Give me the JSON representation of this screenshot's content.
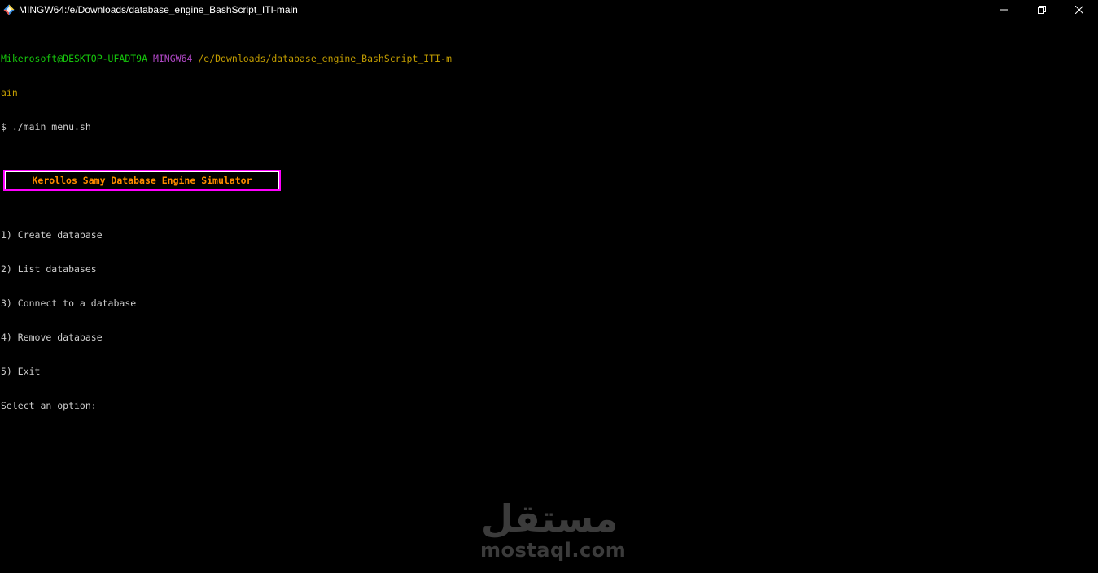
{
  "window": {
    "title": "MINGW64:/e/Downloads/database_engine_BashScript_ITI-main",
    "app_icon": "mingw-diamond-icon",
    "controls": [
      "minimize-icon",
      "restore-icon",
      "close-icon"
    ]
  },
  "terminal": {
    "prompt": {
      "user_host": "Mikerosoft@DESKTOP-UFADT9A",
      "env": "MINGW64",
      "path_part1": "/e/Downloads/database_engine_BashScript_ITI-m",
      "path_part2": "ain",
      "command": "$ ./main_menu.sh"
    },
    "banner": "Kerollos Samy Database Engine Simulator",
    "menu_items": [
      "1) Create database",
      "2) List databases",
      "3) Connect to a database",
      "4) Remove database",
      "5) Exit"
    ],
    "input_prompt": "Select an option:"
  },
  "watermark": {
    "arabic": "مستقل",
    "latin": "mostaql.com"
  },
  "colors": {
    "background": "#000000",
    "foreground": "#cccccc",
    "user_host": "#16c60c",
    "env": "#b148c6",
    "path": "#c19c00",
    "banner_text": "#ff8c00",
    "banner_border": "#ff00ff"
  }
}
